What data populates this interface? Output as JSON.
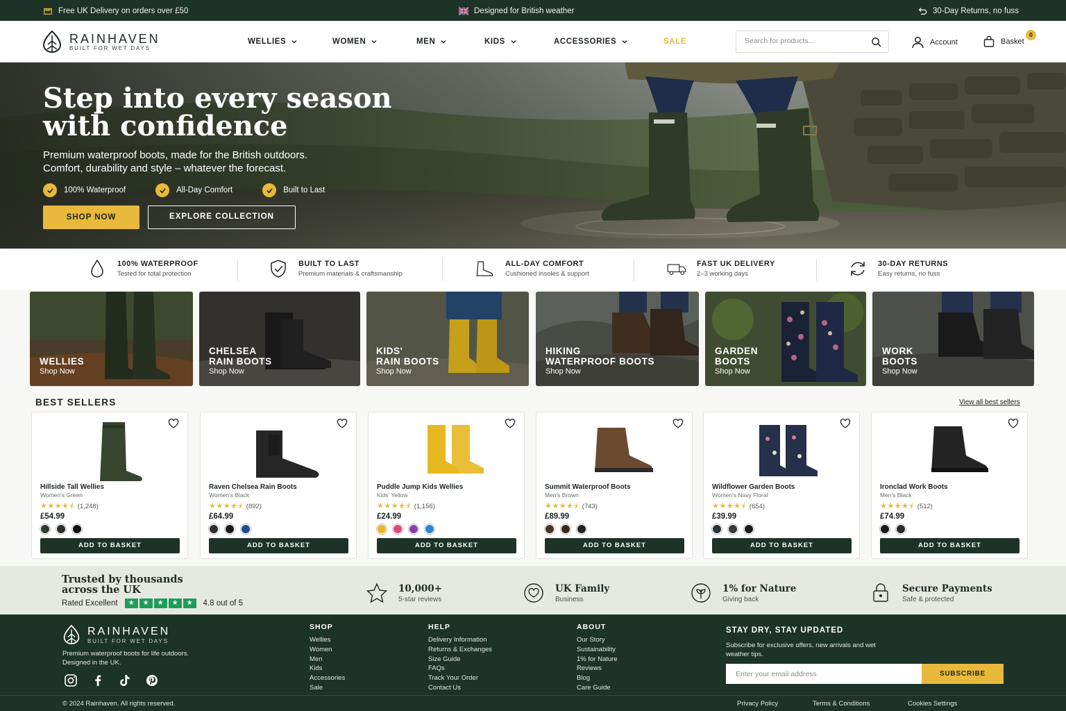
{
  "topbar": {
    "delivery": "Free UK Delivery on orders over £50",
    "weather": "Designed for British weather",
    "returns": "30-Day Returns, no fuss"
  },
  "brand": {
    "name": "RAINHAVEN",
    "tagline": "BUILT FOR WET DAYS"
  },
  "nav": {
    "items": [
      "WELLIES",
      "WOMEN",
      "MEN",
      "KIDS",
      "ACCESSORIES"
    ],
    "sale": "SALE"
  },
  "search": {
    "placeholder": "Search for products..."
  },
  "account": {
    "label": "Account"
  },
  "basket": {
    "label": "Basket",
    "count": "0"
  },
  "hero": {
    "title_line1": "Step into every season",
    "title_line2": "with confidence",
    "subtitle_line1": "Premium waterproof boots, made for the British outdoors.",
    "subtitle_line2": "Comfort, durability and style – whatever the forecast.",
    "features": [
      "100% Waterproof",
      "All-Day Comfort",
      "Built to Last"
    ],
    "cta_primary": "SHOP NOW",
    "cta_secondary": "EXPLORE COLLECTION"
  },
  "values": [
    {
      "icon": "water-drop-icon",
      "title": "100% WATERPROOF",
      "sub": "Tested for total protection"
    },
    {
      "icon": "shield-check-icon",
      "title": "BUILT TO LAST",
      "sub": "Premium materials & craftsmanship"
    },
    {
      "icon": "boot-icon",
      "title": "ALL-DAY COMFORT",
      "sub": "Cushioned insoles & support"
    },
    {
      "icon": "truck-icon",
      "title": "FAST UK DELIVERY",
      "sub": "2–3 working days"
    },
    {
      "icon": "returns-icon",
      "title": "30-DAY RETURNS",
      "sub": "Easy returns, no fuss"
    }
  ],
  "categories": [
    {
      "line1": "WELLIES",
      "line2": "",
      "cta": "Shop Now"
    },
    {
      "line1": "CHELSEA",
      "line2": "RAIN BOOTS",
      "cta": "Shop Now"
    },
    {
      "line1": "KIDS'",
      "line2": "RAIN BOOTS",
      "cta": "Shop Now"
    },
    {
      "line1": "HIKING",
      "line2": "WATERPROOF BOOTS",
      "cta": "Shop Now"
    },
    {
      "line1": "GARDEN",
      "line2": "BOOTS",
      "cta": "Shop Now"
    },
    {
      "line1": "WORK",
      "line2": "BOOTS",
      "cta": "Shop Now"
    }
  ],
  "bestsellers": {
    "title": "BEST SELLERS",
    "view_all": "View all best sellers",
    "add_label": "ADD TO BASKET",
    "products": [
      {
        "name": "Hillside Tall Wellies",
        "variant": "Women's Green",
        "reviews": "(1,248)",
        "price": "£54.99",
        "rating": 4.5,
        "swatches": [
          "#2f3d2c",
          "#2c2f2b",
          "#111111"
        ],
        "boot_color": "#384630"
      },
      {
        "name": "Raven Chelsea Rain Boots",
        "variant": "Women's Black",
        "reviews": "(892)",
        "price": "£64.99",
        "rating": 4.5,
        "swatches": [
          "#2e2e2e",
          "#1a1a1a",
          "#1f4f93"
        ],
        "boot_color": "#262626"
      },
      {
        "name": "Puddle Jump Kids Wellies",
        "variant": "Kids' Yellow",
        "reviews": "(1,156)",
        "price": "£24.99",
        "rating": 4.5,
        "swatches": [
          "#e8b91f",
          "#e0487a",
          "#8a3fa8",
          "#2e84d6"
        ],
        "boot_color": "#e6b820"
      },
      {
        "name": "Summit Waterproof Boots",
        "variant": "Men's Brown",
        "reviews": "(743)",
        "price": "£89.99",
        "rating": 4.5,
        "swatches": [
          "#4a3424",
          "#3b2a1c",
          "#222222"
        ],
        "boot_color": "#6a4a31"
      },
      {
        "name": "Wildflower Garden Boots",
        "variant": "Women's Navy Floral",
        "reviews": "(654)",
        "price": "£39.99",
        "rating": 4.5,
        "swatches": [
          "#2d3240",
          "#3a3a3a",
          "#1a1a1a"
        ],
        "boot_color": "#25304a"
      },
      {
        "name": "Ironclad Work Boots",
        "variant": "Men's Black",
        "reviews": "(512)",
        "price": "£74.99",
        "rating": 4.5,
        "swatches": [
          "#1a1a1a",
          "#2c2c2c"
        ],
        "boot_color": "#242424"
      }
    ]
  },
  "trust": {
    "title": "Trusted by thousands across the UK",
    "rated_label": "Rated Excellent",
    "score": "4.8 out of 5",
    "items": [
      {
        "icon": "star-icon",
        "title": "10,000+",
        "sub": "5-star reviews"
      },
      {
        "icon": "heart-leaf-icon",
        "title": "UK Family",
        "sub": "Business"
      },
      {
        "icon": "leaf-icon",
        "title": "1% for Nature",
        "sub": "Giving back"
      },
      {
        "icon": "lock-icon",
        "title": "Secure Payments",
        "sub": "Safe & protected"
      }
    ]
  },
  "footer": {
    "description": "Premium waterproof boots for life outdoors. Designed in the UK.",
    "social": [
      "instagram-icon",
      "facebook-icon",
      "tiktok-icon",
      "pinterest-icon"
    ],
    "columns": [
      {
        "title": "SHOP",
        "links": [
          "Wellies",
          "Women",
          "Men",
          "Kids",
          "Accessories",
          "Sale"
        ]
      },
      {
        "title": "HELP",
        "links": [
          "Delivery Information",
          "Returns & Exchanges",
          "Size Guide",
          "FAQs",
          "Track Your Order",
          "Contact Us"
        ]
      },
      {
        "title": "ABOUT",
        "links": [
          "Our Story",
          "Sustainability",
          "1% for Nature",
          "Reviews",
          "Blog",
          "Care Guide"
        ]
      }
    ],
    "newsletter": {
      "title": "STAY DRY, STAY UPDATED",
      "sub": "Subscribe for exclusive offers, new arrivals and wet weather tips.",
      "placeholder": "Enter your email address",
      "button": "SUBSCRIBE"
    },
    "copyright": "© 2024 Rainhaven. All rights reserved.",
    "legal": [
      "Privacy Policy",
      "Terms & Conditions",
      "Cookies Settings"
    ]
  },
  "colors": {
    "brand_green": "#1d3327",
    "accent_yellow": "#e8b93b",
    "sale": "#e8b93b"
  }
}
